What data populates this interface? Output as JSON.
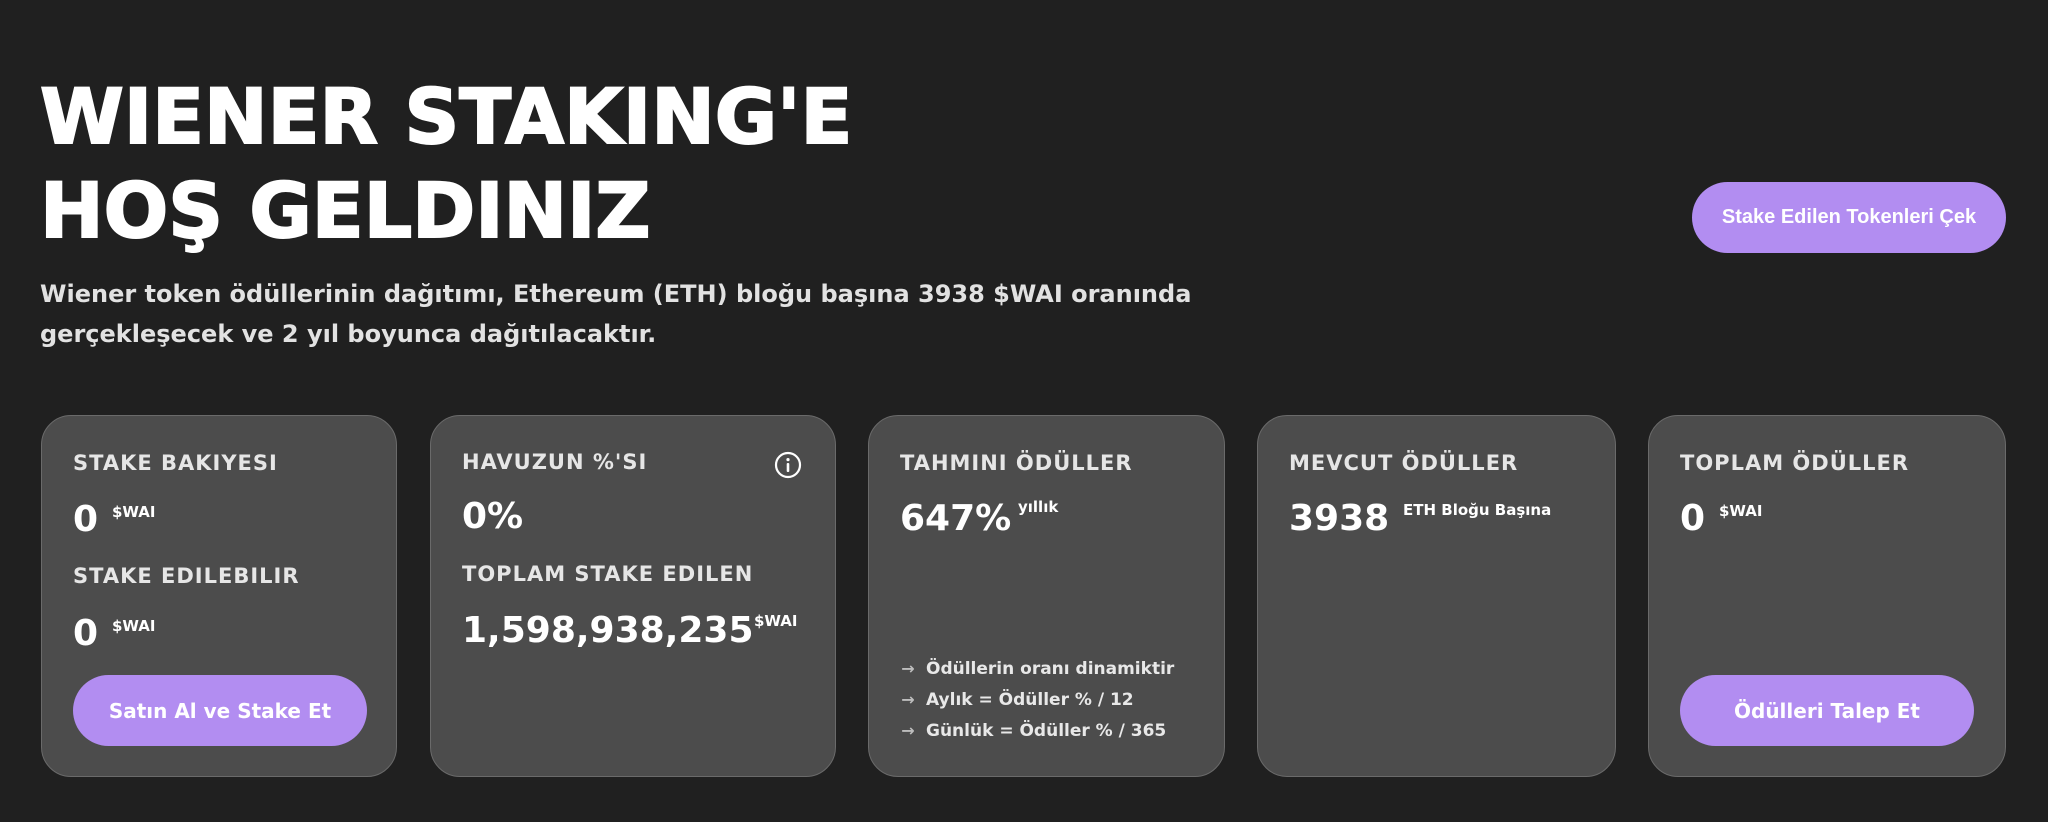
{
  "hero": {
    "title": "WIENER STAKING'E HOŞ GELDINIZ",
    "description": "Wiener token ödüllerinin dağıtımı, Ethereum (ETH) bloğu başına 3938 $WAI oranında gerçekleşecek ve 2 yıl boyunca dağıtılacaktır.",
    "withdraw_button": "Stake Edilen Tokenleri Çek"
  },
  "cards": {
    "stake_balance": {
      "label": "STAKE BAKIYESI",
      "value": "0",
      "unit": "$WAI",
      "stakeable_label": "STAKE EDILEBILIR",
      "stakeable_value": "0",
      "stakeable_unit": "$WAI",
      "button": "Satın Al ve Stake Et"
    },
    "pool_share": {
      "label": "HAVUZUN %'SI",
      "value": "0%",
      "total_label": "TOPLAM STAKE EDILEN",
      "total_value": "1,598,938,235",
      "total_unit": "$WAI",
      "info_icon": "info-circle-icon"
    },
    "estimated_rewards": {
      "label": "TAHMINI ÖDÜLLER",
      "value": "647%",
      "unit": "yıllık",
      "notes": [
        "Ödüllerin oranı dinamiktir",
        "Aylık = Ödüller % / 12",
        "Günlük = Ödüller % / 365"
      ],
      "note_icon": "arrow-right-icon"
    },
    "current_rewards": {
      "label": "MEVCUT ÖDÜLLER",
      "value": "3938",
      "unit": "ETH Bloğu Başına"
    },
    "total_rewards": {
      "label": "TOPLAM ÖDÜLLER",
      "value": "0",
      "unit": "$WAI",
      "button": "Ödülleri Talep Et"
    }
  },
  "colors": {
    "background": "#202020",
    "card": "#4c4c4c",
    "accent": "#b28df1",
    "text": "#ffffff"
  }
}
